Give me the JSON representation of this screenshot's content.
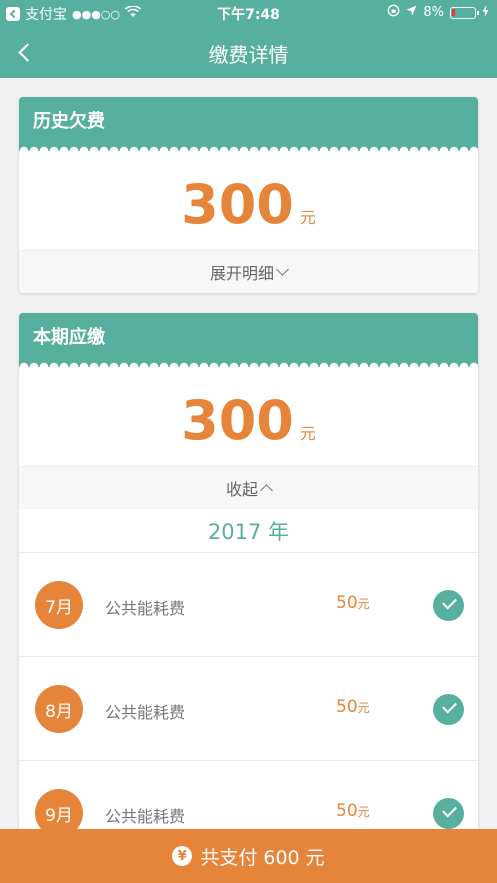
{
  "status_bar": {
    "app_name": "支付宝",
    "signal": "●●●○○",
    "time": "下午7:48",
    "battery": "8%"
  },
  "nav": {
    "title": "缴费详情"
  },
  "history": {
    "title": "历史欠费",
    "amount": "300",
    "unit": "元",
    "toggle_label": "展开明细"
  },
  "current": {
    "title": "本期应缴",
    "amount": "300",
    "unit": "元",
    "toggle_label": "收起",
    "year_label": "2017 年",
    "items": [
      {
        "month": "7月",
        "name": "公共能耗费",
        "amount": "50",
        "unit": "元",
        "paid": true
      },
      {
        "month": "8月",
        "name": "公共能耗费",
        "amount": "50",
        "unit": "元",
        "paid": true
      },
      {
        "month": "9月",
        "name": "公共能耗费",
        "amount": "50",
        "unit": "元",
        "paid": true
      }
    ]
  },
  "pay": {
    "icon_symbol": "¥",
    "label": "共支付 600 元"
  },
  "colors": {
    "primary": "#57b09e",
    "accent": "#e6843a"
  }
}
